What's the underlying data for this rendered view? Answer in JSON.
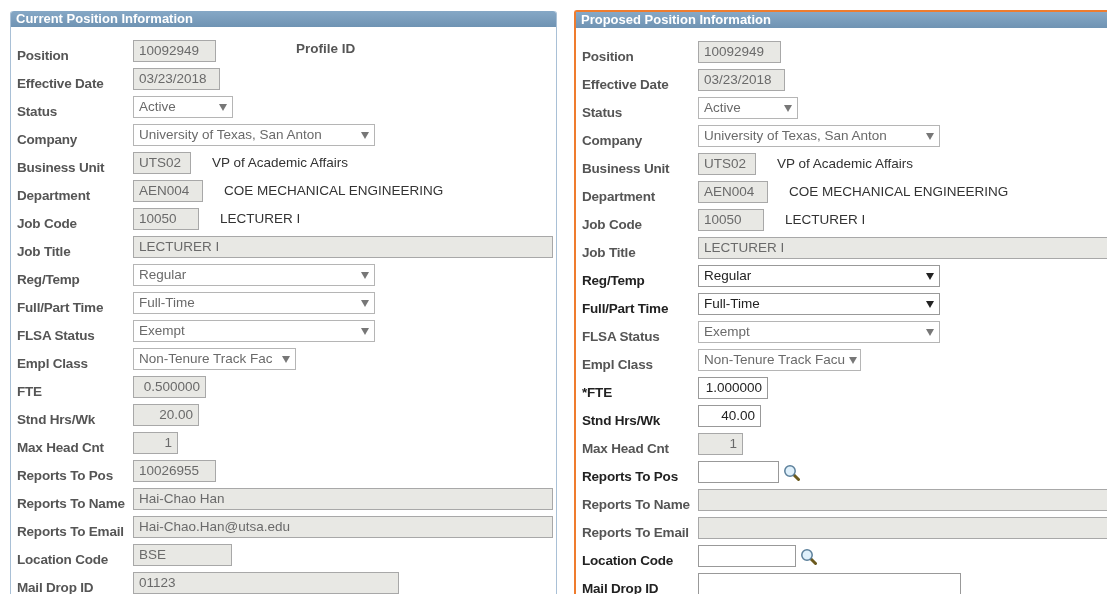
{
  "panels": [
    {
      "title": "Current Position Information",
      "highlighted": false,
      "rows": [
        {
          "label": "Position",
          "field": {
            "kind": "text",
            "disabled": true,
            "value": "10092949"
          },
          "extra": {
            "kind": "label",
            "text": "Profile ID"
          }
        },
        {
          "label": "Effective Date",
          "field": {
            "kind": "text",
            "disabled": true,
            "value": "03/23/2018"
          }
        },
        {
          "label": "Status",
          "field": {
            "kind": "select",
            "disabled": true,
            "value": "Active"
          }
        },
        {
          "label": "Company",
          "field": {
            "kind": "select",
            "disabled": true,
            "value": "University of Texas, San Anton"
          }
        },
        {
          "label": "Business Unit",
          "field": {
            "kind": "text",
            "disabled": true,
            "value": "UTS02"
          },
          "extra": {
            "kind": "description",
            "text": "VP of Academic Affairs"
          }
        },
        {
          "label": "Department",
          "field": {
            "kind": "text",
            "disabled": true,
            "value": "AEN004"
          },
          "extra": {
            "kind": "description",
            "text": "COE MECHANICAL ENGINEERING"
          }
        },
        {
          "label": "Job Code",
          "field": {
            "kind": "text",
            "disabled": true,
            "value": "10050"
          },
          "extra": {
            "kind": "description",
            "text": "LECTURER I"
          }
        },
        {
          "label": "Job Title",
          "field": {
            "kind": "text",
            "disabled": true,
            "value": "LECTURER I"
          }
        },
        {
          "label": "Reg/Temp",
          "field": {
            "kind": "select",
            "disabled": true,
            "value": "Regular"
          }
        },
        {
          "label": "Full/Part Time",
          "field": {
            "kind": "select",
            "disabled": true,
            "value": "Full-Time"
          }
        },
        {
          "label": "FLSA Status",
          "field": {
            "kind": "select",
            "disabled": true,
            "value": "Exempt"
          }
        },
        {
          "label": "Empl Class",
          "field": {
            "kind": "select",
            "disabled": true,
            "value": "Non-Tenure Track Fac"
          }
        },
        {
          "label": "FTE",
          "field": {
            "kind": "number",
            "disabled": true,
            "value": "0.500000"
          }
        },
        {
          "label": "Stnd Hrs/Wk",
          "field": {
            "kind": "number",
            "disabled": true,
            "value": "20.00"
          }
        },
        {
          "label": "Max Head Cnt",
          "field": {
            "kind": "number",
            "disabled": true,
            "value": "1"
          }
        },
        {
          "label": "Reports To Pos",
          "field": {
            "kind": "text",
            "disabled": true,
            "value": "10026955"
          }
        },
        {
          "label": "Reports To Name",
          "field": {
            "kind": "text",
            "disabled": true,
            "value": "Hai-Chao Han"
          }
        },
        {
          "label": "Reports To Email",
          "field": {
            "kind": "text",
            "disabled": true,
            "value": "Hai-Chao.Han@utsa.edu"
          }
        },
        {
          "label": "Location Code",
          "field": {
            "kind": "text",
            "disabled": true,
            "value": "BSE"
          }
        },
        {
          "label": "Mail Drop ID",
          "field": {
            "kind": "text",
            "disabled": true,
            "value": "01123"
          }
        }
      ]
    },
    {
      "title": "Proposed Position Information",
      "highlighted": true,
      "rows": [
        {
          "label": "Position",
          "field": {
            "kind": "text",
            "disabled": true,
            "value": "10092949"
          }
        },
        {
          "label": "Effective Date",
          "field": {
            "kind": "text",
            "disabled": true,
            "value": "03/23/2018"
          }
        },
        {
          "label": "Status",
          "field": {
            "kind": "select",
            "disabled": true,
            "value": "Active"
          }
        },
        {
          "label": "Company",
          "field": {
            "kind": "select",
            "disabled": true,
            "value": "University of Texas, San Anton"
          }
        },
        {
          "label": "Business Unit",
          "field": {
            "kind": "text",
            "disabled": true,
            "value": "UTS02"
          },
          "extra": {
            "kind": "description",
            "text": "VP of Academic Affairs"
          }
        },
        {
          "label": "Department",
          "field": {
            "kind": "text",
            "disabled": true,
            "value": "AEN004"
          },
          "extra": {
            "kind": "description",
            "text": "COE MECHANICAL ENGINEERING"
          }
        },
        {
          "label": "Job Code",
          "field": {
            "kind": "text",
            "disabled": true,
            "value": "10050"
          },
          "extra": {
            "kind": "description",
            "text": "LECTURER I"
          }
        },
        {
          "label": "Job Title",
          "field": {
            "kind": "text",
            "disabled": true,
            "value": "LECTURER I"
          }
        },
        {
          "label": "Reg/Temp",
          "field": {
            "kind": "select",
            "disabled": false,
            "value": "Regular"
          }
        },
        {
          "label": "Full/Part Time",
          "field": {
            "kind": "select",
            "disabled": false,
            "value": "Full-Time"
          }
        },
        {
          "label": "FLSA Status",
          "field": {
            "kind": "select",
            "disabled": true,
            "value": "Exempt"
          }
        },
        {
          "label": "Empl Class",
          "field": {
            "kind": "select",
            "disabled": true,
            "value": "Non-Tenure Track Facu"
          }
        },
        {
          "label": "*FTE",
          "field": {
            "kind": "number",
            "disabled": false,
            "value": "1.000000"
          }
        },
        {
          "label": "Stnd Hrs/Wk",
          "field": {
            "kind": "number",
            "disabled": false,
            "value": "40.00"
          }
        },
        {
          "label": "Max Head Cnt",
          "field": {
            "kind": "number",
            "disabled": true,
            "value": "1"
          }
        },
        {
          "label": "Reports To Pos",
          "field": {
            "kind": "lookup",
            "disabled": false
          }
        },
        {
          "label": "Reports To Name",
          "field": {
            "kind": "text",
            "disabled": true
          }
        },
        {
          "label": "Reports To Email",
          "field": {
            "kind": "text",
            "disabled": true
          }
        },
        {
          "label": "Location Code",
          "field": {
            "kind": "lookup",
            "disabled": false
          }
        },
        {
          "label": "Mail Drop ID",
          "field": {
            "kind": "text",
            "disabled": false
          }
        }
      ]
    }
  ]
}
